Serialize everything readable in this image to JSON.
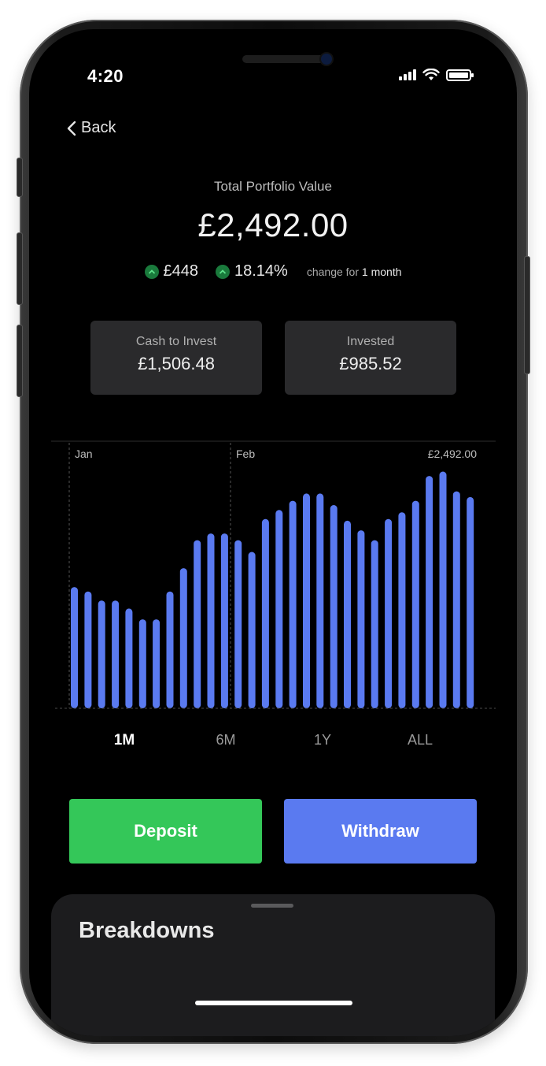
{
  "status_bar": {
    "time": "4:20"
  },
  "nav": {
    "back_label": "Back"
  },
  "portfolio": {
    "title": "Total Portfolio Value",
    "total_value": "£2,492.00",
    "change_amount": "£448",
    "change_percent": "18.14%",
    "change_label": "change for",
    "change_period": "1 month"
  },
  "cards": [
    {
      "label": "Cash to Invest",
      "value": "£1,506.48"
    },
    {
      "label": "Invested",
      "value": "£985.52"
    }
  ],
  "chart_data": {
    "type": "bar",
    "month_labels": [
      "Jan",
      "Feb"
    ],
    "current_value_label": "£2,492.00",
    "values": [
      1549,
      1492,
      1377,
      1377,
      1274,
      1136,
      1136,
      1492,
      1790,
      2147,
      2233,
      2233,
      2147,
      1997,
      2417,
      2533,
      2651,
      2743,
      2743,
      2596,
      2396,
      2273,
      2147,
      2417,
      2504,
      2651,
      2968,
      3024,
      2771,
      2698
    ],
    "ylim": [
      0,
      3200
    ],
    "bar_color": "#5a7af0",
    "grid": false
  },
  "periods": [
    {
      "label": "1M",
      "active": true
    },
    {
      "label": "6M",
      "active": false
    },
    {
      "label": "1Y",
      "active": false
    },
    {
      "label": "ALL",
      "active": false
    }
  ],
  "actions": {
    "deposit": "Deposit",
    "withdraw": "Withdraw"
  },
  "sheet": {
    "heading": "Breakdowns"
  },
  "colors": {
    "positive": "#34c759",
    "accent": "#5a7af0"
  }
}
